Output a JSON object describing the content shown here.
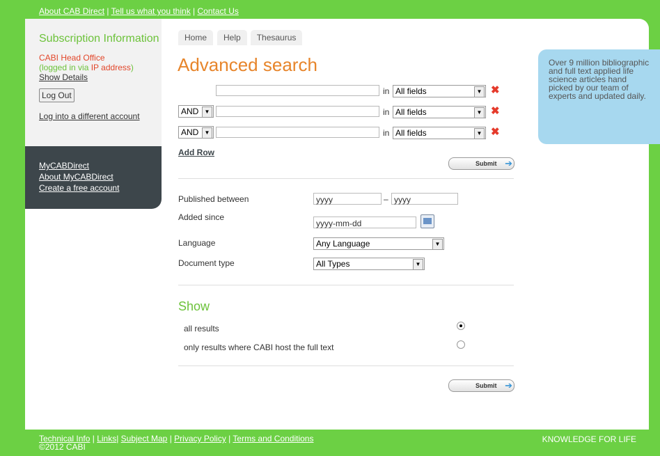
{
  "top_links": [
    "About CAB Direct",
    "Tell us what you think",
    "Contact Us"
  ],
  "top_sep": "|",
  "sidebar": {
    "title": "Subscription Information",
    "org": "CABI Head Office",
    "logged_prefix": "(logged in via ",
    "logged_ip": "IP address",
    "logged_suffix": ")",
    "show_details": "Show Details",
    "logout": "Log Out",
    "different_account": "Log into a different account",
    "links": [
      "MyCABDirect",
      "About MyCABDirect",
      "Create a free account"
    ]
  },
  "tabs": [
    "Home",
    "Help",
    "Thesaurus"
  ],
  "page_title": "Advanced search",
  "search_rows": [
    {
      "operator": "",
      "term": "",
      "in_label": "in",
      "field": "All fields"
    },
    {
      "operator": "AND",
      "term": "",
      "in_label": "in",
      "field": "All fields"
    },
    {
      "operator": "AND",
      "term": "",
      "in_label": "in",
      "field": "All fields"
    }
  ],
  "add_row": "Add Row",
  "submit_label": "Submit",
  "filters": {
    "published_label": "Published between",
    "published_from": "yyyy",
    "published_dash": "–",
    "published_to": "yyyy",
    "added_label": "Added since",
    "added_value": "yyyy-mm-dd",
    "language_label": "Language",
    "language_value": "Any Language",
    "doctype_label": "Document type",
    "doctype_value": "All Types"
  },
  "show": {
    "title": "Show",
    "options": [
      {
        "label": "all results",
        "selected": true
      },
      {
        "label": "only results where CABI host the full text",
        "selected": false
      }
    ]
  },
  "promo": "Over 9 million bibliographic and full text applied life science articles hand picked by our team of experts and updated daily.",
  "footer": {
    "links": [
      "Technical Info",
      "Links",
      "Subject Map",
      "Privacy Policy",
      "Terms and Conditions"
    ],
    "copyright": "©2012 CABI",
    "tagline": "KNOWLEDGE FOR LIFE"
  },
  "colors": {
    "brand_green": "#6cd044",
    "title_orange": "#e7852b",
    "dark_panel": "#3d464b",
    "promo_blue": "#a7d8ef",
    "delete_red": "#e53a2b"
  }
}
